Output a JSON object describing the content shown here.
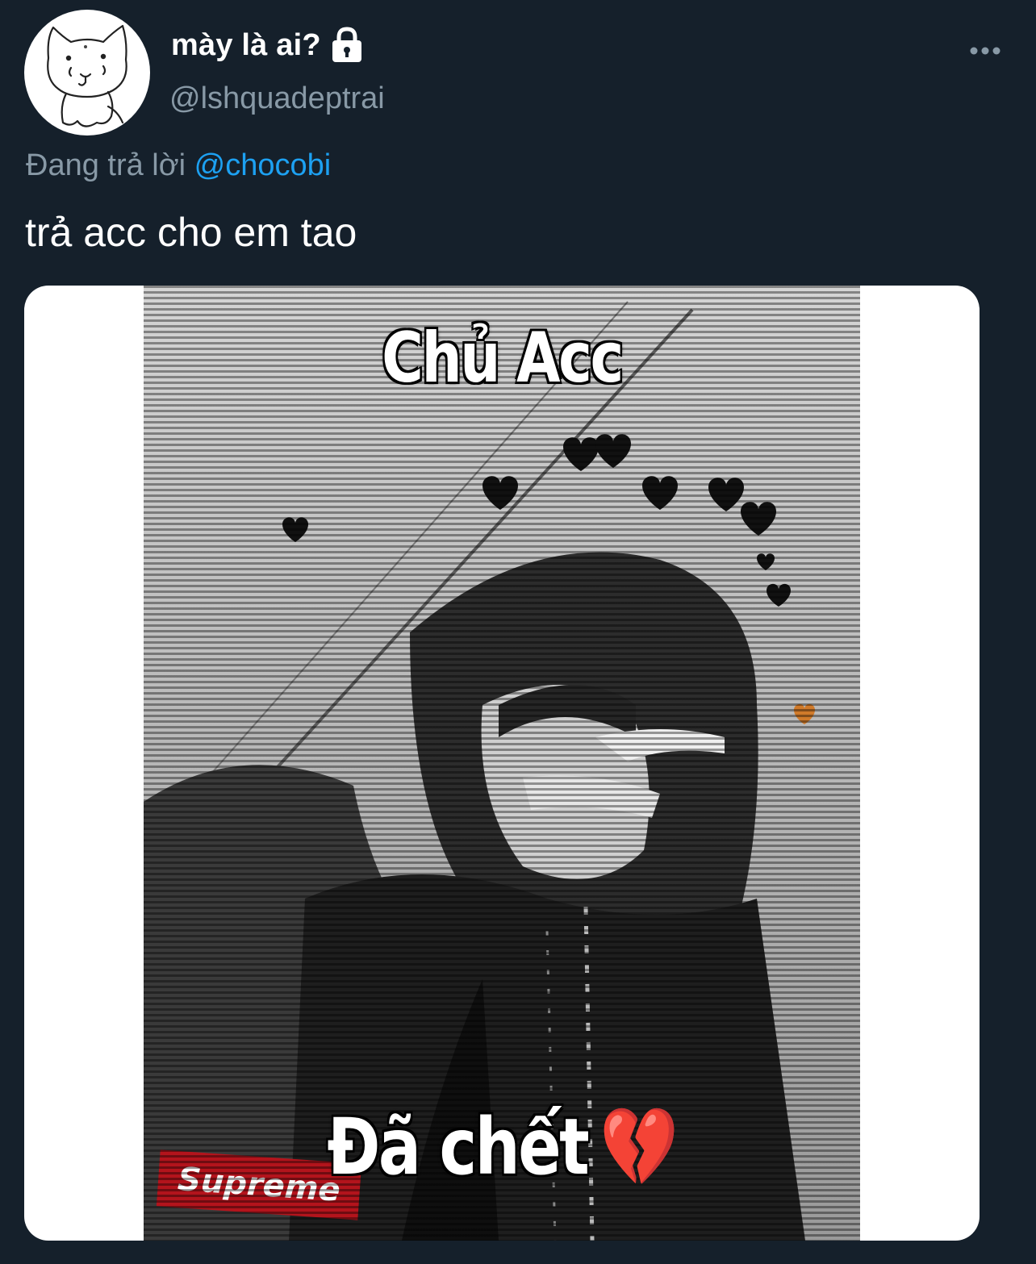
{
  "author": {
    "display_name": "mày là ai?",
    "handle": "@lshquadeptrai",
    "avatar_icon": "cat-doodle-avatar-icon",
    "protected_icon": "lock-icon"
  },
  "more_icon": "more-horizontal-icon",
  "reply_context": {
    "prefix": "Đang trả lời",
    "mention": "@chocobi"
  },
  "tweet": {
    "text": "trả acc cho em tao"
  },
  "media": {
    "caption_top": "Chủ Acc",
    "caption_bottom": "Đã chết",
    "caption_emoji": "💔",
    "brand_label": "Supreme"
  },
  "colors": {
    "background": "#15202b",
    "text_primary": "#ffffff",
    "text_secondary": "#8899a6",
    "link": "#1da1f2"
  }
}
